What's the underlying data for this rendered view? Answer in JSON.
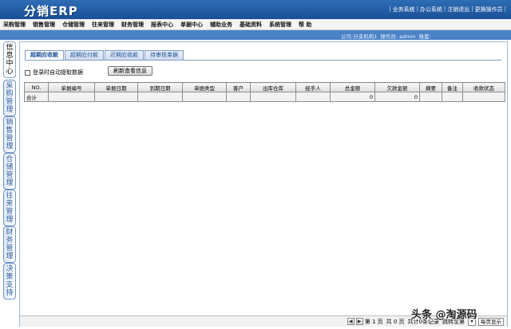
{
  "app": {
    "logo": "分销ERP"
  },
  "toplinks": [
    "业务系统",
    "办公系统",
    "注销退出",
    "更换操作员"
  ],
  "menu": [
    "采购管理",
    "销售管理",
    "仓储管理",
    "往来管理",
    "财务管理",
    "报表中心",
    "单据中心",
    "辅助业务",
    "基础资料",
    "系统管理",
    "帮 助"
  ],
  "infobar": {
    "company": "公司:分支机构1",
    "operator": "操作员: admin",
    "role": "账套:"
  },
  "sidebar": {
    "tabs": [
      {
        "label": "信息中心"
      },
      {
        "label": "采购管理"
      },
      {
        "label": "销售管理"
      },
      {
        "label": "仓储管理"
      },
      {
        "label": "往来管理"
      },
      {
        "label": "财务管理"
      },
      {
        "label": "决策支持"
      }
    ]
  },
  "tabs": [
    "超期应收款",
    "超期应付款",
    "近期应收款",
    "待审核单据"
  ],
  "options": {
    "auto_fetch_label": "登录时自动提取数据",
    "refresh_label": "刷新查看信息"
  },
  "table": {
    "headers": [
      "NO.",
      "单据编号",
      "单据日期",
      "到期日期",
      "单据类型",
      "客户",
      "出库仓库",
      "经手人",
      "总金额",
      "欠款金额",
      "摘要",
      "备注",
      "收款状态"
    ],
    "total_row": {
      "label": "合计",
      "total_amount": "0",
      "owed_amount": "0"
    }
  },
  "pager": {
    "page_label": "第 1 页",
    "total_pages": "共 0 页",
    "total_records": "共计0条记录",
    "jump_label": "跳转至第",
    "page_size": "每页显示"
  },
  "watermark": "头条 @淘源码"
}
